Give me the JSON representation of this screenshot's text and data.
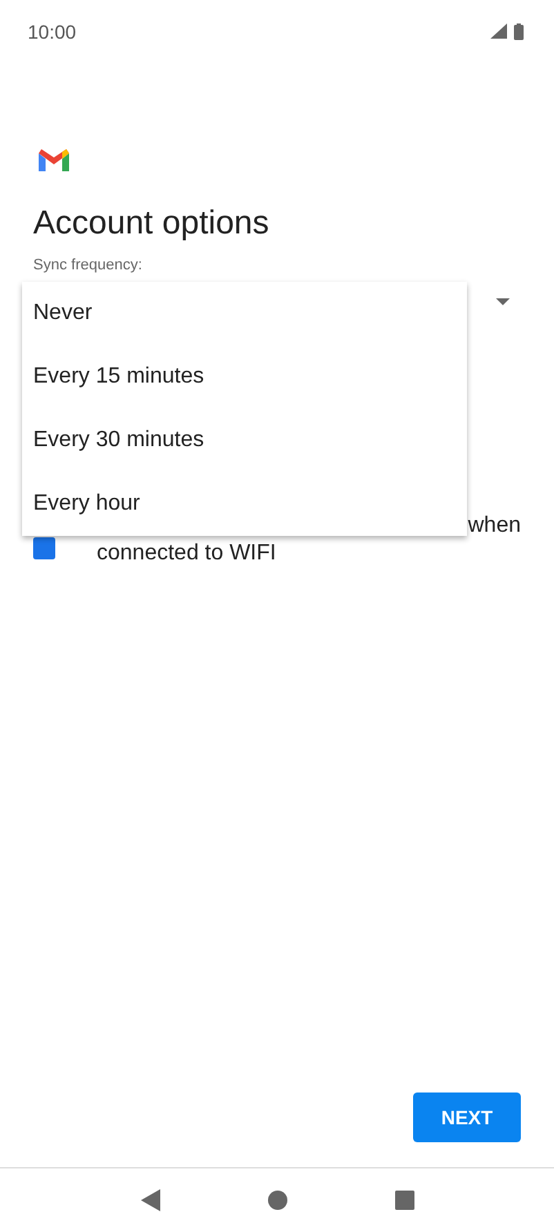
{
  "status_bar": {
    "time": "10:00"
  },
  "title": "Account options",
  "sync_field": {
    "label": "Sync frequency:"
  },
  "checkbox": {
    "checked": true,
    "label_end": "when",
    "label_line_2": "connected to WIFI"
  },
  "dropdown_menu": [
    {
      "label": "Never"
    },
    {
      "label": "Every 15 minutes"
    },
    {
      "label": "Every 30 minutes"
    },
    {
      "label": "Every hour"
    }
  ],
  "next_button": "NEXT"
}
